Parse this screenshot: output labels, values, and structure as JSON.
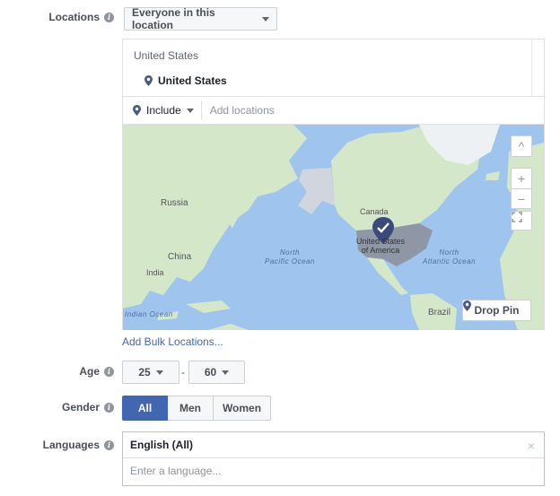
{
  "locations": {
    "label": "Locations",
    "dropdown": "Everyone in this location",
    "list_heading": "United States",
    "selected": "United States",
    "include_label": "Include",
    "add_placeholder": "Add locations",
    "add_bulk": "Add Bulk Locations..."
  },
  "map": {
    "labels": {
      "russia": "Russia",
      "china": "China",
      "india": "India",
      "canada": "Canada",
      "usa_line1": "United States",
      "usa_line2": "of America",
      "north_pacific_1": "North",
      "north_pacific_2": "Pacific Ocean",
      "north_atlantic_1": "North",
      "north_atlantic_2": "Atlantic Ocean",
      "indian_ocean": "Indian Ocean",
      "brazil": "Brazil"
    },
    "controls": {
      "collapse": "^",
      "zoom_in": "+",
      "zoom_out": "−"
    },
    "drop_pin": "Drop Pin",
    "colors": {
      "water": "#9fc4ee",
      "land": "#d4e8c9",
      "selected_region": "#8f97a7",
      "marker": "#3b4a7a"
    }
  },
  "age": {
    "label": "Age",
    "min": "25",
    "separator": "-",
    "max": "60"
  },
  "gender": {
    "label": "Gender",
    "options": [
      "All",
      "Men",
      "Women"
    ],
    "selected": "All"
  },
  "languages": {
    "label": "Languages",
    "selected": "English (All)",
    "remove": "×",
    "placeholder": "Enter a language..."
  },
  "icons": {
    "info": "i",
    "pin": "map-pin-icon",
    "caret": "caret-down-icon",
    "fullscreen": "fullscreen-icon"
  },
  "accent": "#4267b2"
}
